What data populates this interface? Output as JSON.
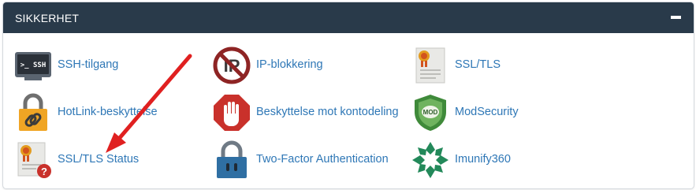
{
  "section": {
    "title": "SIKKERHET",
    "collapse_icon": "minus-icon"
  },
  "items": [
    {
      "label": "SSH-tilgang",
      "icon": "terminal-icon"
    },
    {
      "label": "IP-blokkering",
      "icon": "ip-block-icon"
    },
    {
      "label": "SSL/TLS",
      "icon": "certificate-icon"
    },
    {
      "label": "HotLink-beskyttelse",
      "icon": "chain-lock-icon"
    },
    {
      "label": "Beskyttelse mot kontodeling",
      "icon": "stop-hand-icon"
    },
    {
      "label": "ModSecurity",
      "icon": "mod-shield-icon"
    },
    {
      "label": "SSL/TLS Status",
      "icon": "certificate-question-icon"
    },
    {
      "label": "Two-Factor Authentication",
      "icon": "padlock-icon"
    },
    {
      "label": "Imunify360",
      "icon": "imunify-icon"
    }
  ],
  "terminal_icon_text": ">_ SSH",
  "ip_icon_text": "IP",
  "mod_icon_text": "MOD",
  "colors": {
    "header_bg": "#293a4a",
    "link": "#2e77b6",
    "arrow": "#e02020"
  }
}
